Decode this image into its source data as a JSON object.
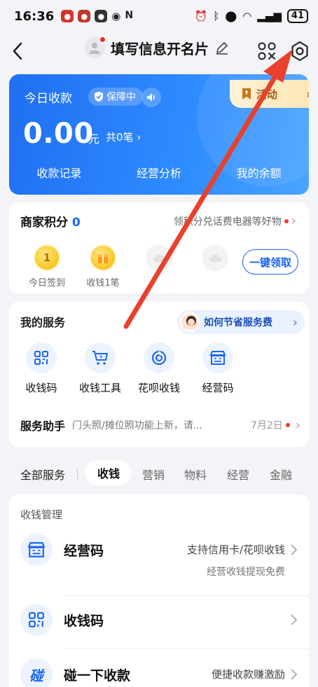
{
  "status_bar": {
    "time": "16:36",
    "battery": "41"
  },
  "header": {
    "title": "填写信息开名片"
  },
  "blue_card": {
    "today_label": "今日收款",
    "guard_label": "保障中",
    "activity_label": "活动",
    "amount": "0.00",
    "amount_unit": "元",
    "count_text": "共0笔",
    "links": [
      "收款记录",
      "经营分析",
      "我的余额"
    ]
  },
  "points": {
    "title": "商家积分",
    "value": "0",
    "promo": "领积分兑话费电器等好物",
    "rewards": [
      {
        "icon_text": "1",
        "label": "今日签到"
      },
      {
        "icon_text": "",
        "label": "收钱1笔"
      }
    ],
    "claim_label": "一键领取"
  },
  "services": {
    "title": "我的服务",
    "fee_label": "如何节省服务费",
    "items": [
      "收钱码",
      "收钱工具",
      "花呗收钱",
      "经营码"
    ],
    "assistant_title": "服务助手",
    "assistant_text": "门头照/摊位照功能上新，请...",
    "assistant_date": "7月2日"
  },
  "tabs": {
    "all_label": "全部服务",
    "items": [
      "收钱",
      "营销",
      "物料",
      "经营",
      "金融"
    ],
    "active_index": 0
  },
  "manage": {
    "heading": "收钱管理",
    "rows": [
      {
        "name": "经营码",
        "desc": "支持信用卡/花呗收钱",
        "sub": "经营收钱提现免费"
      },
      {
        "name": "收钱码",
        "desc": "",
        "sub": ""
      },
      {
        "name": "碰一下收款",
        "desc": "便捷收款赚激励",
        "sub": ""
      }
    ]
  },
  "colors": {
    "brand_blue": "#1a66f0",
    "arrow_red": "#e8412c"
  }
}
